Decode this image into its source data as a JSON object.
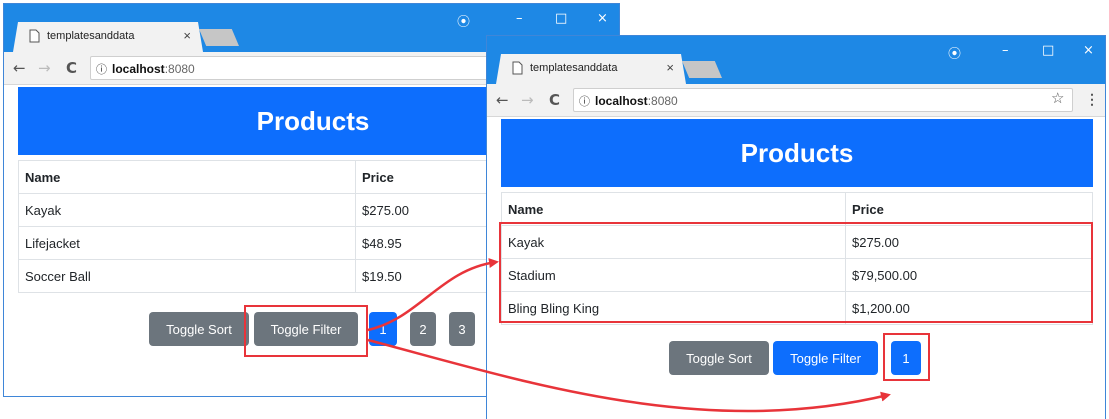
{
  "left_window": {
    "tab_title": "templatesanddata",
    "tab_close": "×",
    "win_controls": {
      "profile": "⦿",
      "minimize": "–",
      "maximize": "□",
      "close": "×"
    },
    "url_host": "localhost",
    "url_port": ":8080",
    "heading": "Products",
    "columns": [
      "Name",
      "Price"
    ],
    "rows": [
      {
        "name": "Kayak",
        "price": "$275.00"
      },
      {
        "name": "Lifejacket",
        "price": "$48.95"
      },
      {
        "name": "Soccer Ball",
        "price": "$19.50"
      }
    ],
    "buttons": {
      "sort": "Toggle Sort",
      "filter": "Toggle Filter"
    },
    "pages": [
      "1",
      "2",
      "3"
    ]
  },
  "right_window": {
    "tab_title": "templatesanddata",
    "tab_close": "×",
    "win_controls": {
      "profile": "⦿",
      "minimize": "–",
      "maximize": "□",
      "close": "×"
    },
    "url_host": "localhost",
    "url_port": ":8080",
    "heading": "Products",
    "columns": [
      "Name",
      "Price"
    ],
    "rows": [
      {
        "name": "Kayak",
        "price": "$275.00"
      },
      {
        "name": "Stadium",
        "price": "$79,500.00"
      },
      {
        "name": "Bling Bling King",
        "price": "$1,200.00"
      }
    ],
    "buttons": {
      "sort": "Toggle Sort",
      "filter": "Toggle Filter"
    },
    "pages": [
      "1"
    ]
  },
  "browser_glyphs": {
    "back": "←",
    "forward": "→",
    "reload": "C",
    "info": "ⓘ",
    "star": "☆",
    "menu": "⋮"
  },
  "icons": [
    "page-icon",
    "close-icon",
    "new-tab-button",
    "back-icon",
    "forward-icon",
    "reload-icon",
    "info-icon",
    "star-icon",
    "menu-icon",
    "profile-icon",
    "minimize-icon",
    "maximize-icon",
    "window-close-icon"
  ],
  "colors": {
    "chrome_blue": "#1e88e5",
    "header_blue": "#0d6efd",
    "button_gray": "#6c757d",
    "highlight_red": "#e8343a"
  }
}
